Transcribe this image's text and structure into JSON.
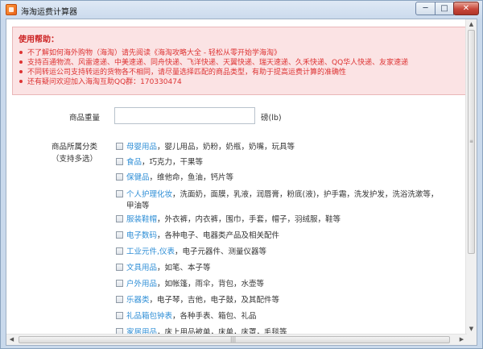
{
  "window": {
    "title": "海淘运费计算器",
    "min_glyph": "─",
    "max_glyph": "□",
    "close_glyph": "✕"
  },
  "help": {
    "title": "使用帮助：",
    "items": [
      "不了解如何海外购物（海淘）请先阅读《海淘攻略大全 - 轻松从零开始学海淘》",
      "支持百通物流、风雷速递、中美速递、同舟快递、飞洋快递、天翼快递、瑞天速递、久禾快递、QQ华人快递、友家速递",
      "不同转运公司支持转运的货物各不相同，请尽量选择匹配的商品类型，有助于提高运费计算的准确性",
      "还有疑问欢迎加入海淘互助QQ群：170330474"
    ]
  },
  "form": {
    "weight_label": "商品重量",
    "weight_value": "",
    "weight_unit": "磅(lb)",
    "category_label_line1": "商品所属分类",
    "category_label_line2": "（支持多选）"
  },
  "categories": [
    {
      "name": "母婴用品",
      "desc": "，婴儿用品，奶粉，奶瓶，奶嘴，玩具等"
    },
    {
      "name": "食品",
      "desc": "，巧克力，干果等"
    },
    {
      "name": "保健品",
      "desc": "，维他命，鱼油，钙片等"
    },
    {
      "name": "个人护理化妆",
      "desc": "，洗面奶，面膜，乳液，润唇膏，粉底(液)，护手霜，洗发护发，洗浴洗漱等，",
      "desc2": "甲油等"
    },
    {
      "name": "服装鞋帽",
      "desc": "，外衣裤，内衣裤，围巾，手套，帽子，羽绒服，鞋等"
    },
    {
      "name": "电子数码",
      "desc": "，各种电子、电器类产品及相关配件"
    },
    {
      "name": "工业元件,仪表",
      "desc": "，电子元器件、测量仪器等"
    },
    {
      "name": "文具用品",
      "desc": "，如笔、本子等"
    },
    {
      "name": "户外用品",
      "desc": "，如帐篷，雨伞，背包，水壶等"
    },
    {
      "name": "乐器类",
      "desc": "，电子琴，吉他，电子鼓，及其配件等"
    },
    {
      "name": "礼品箱包钟表",
      "desc": "，各种手表、箱包、礼品"
    },
    {
      "name": "家居用品",
      "desc": "，床上用品被单，床单，床罩，毛毯等"
    }
  ],
  "scrollbars": {
    "up": "▲",
    "down": "▼",
    "left": "◀",
    "right": "▶",
    "vgrip": "≡",
    "hgrip": "|||"
  }
}
